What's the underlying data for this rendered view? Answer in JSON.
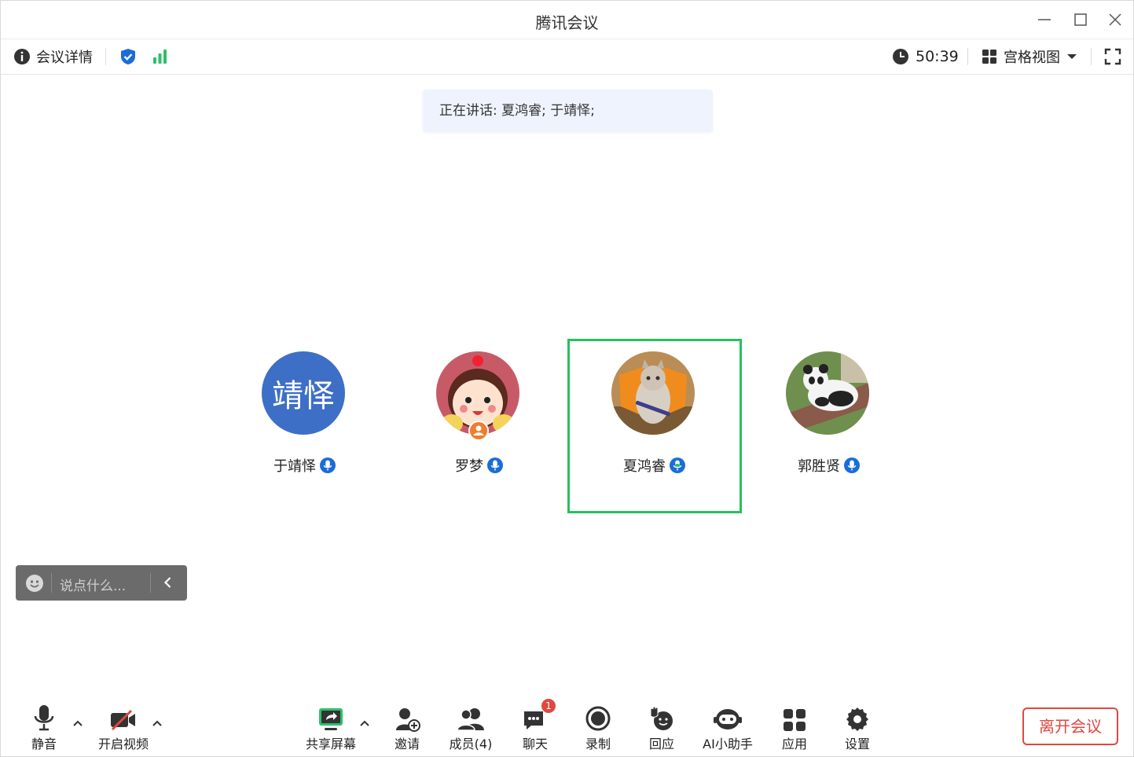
{
  "app": {
    "title": "腾讯会议"
  },
  "infobar": {
    "meeting_details": "会议详情",
    "timer": "50:39",
    "view_mode": "宫格视图"
  },
  "speaking": {
    "text": "正在讲话: 夏鸿睿; 于靖怿;"
  },
  "participants": [
    {
      "name": "于靖怿",
      "avatar_text": "靖怿",
      "avatar_color": "#3d6fc6"
    },
    {
      "name": "罗梦",
      "avatar_text": ""
    },
    {
      "name": "夏鸿睿",
      "avatar_text": "",
      "active_speaker": true
    },
    {
      "name": "郭胜贤",
      "avatar_text": ""
    }
  ],
  "chat": {
    "placeholder": "说点什么..."
  },
  "toolbar": {
    "mute": "静音",
    "video": "开启视频",
    "share": "共享屏幕",
    "invite": "邀请",
    "members": "成员(4)",
    "chat": "聊天",
    "chat_badge": "1",
    "record": "录制",
    "react": "回应",
    "ai": "AI小助手",
    "apps": "应用",
    "settings": "设置"
  },
  "leave": {
    "label": "离开会议"
  },
  "colors": {
    "accent": "#1a6dd9",
    "active_border": "#27c15c",
    "leave": "#e0483f",
    "signal": "#2bc16a"
  }
}
